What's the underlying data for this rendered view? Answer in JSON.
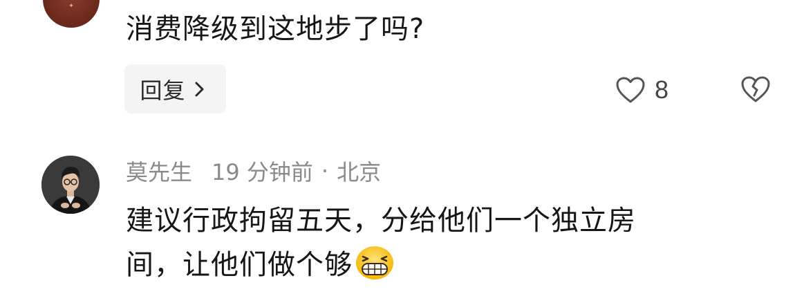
{
  "comment_1": {
    "text": "消费降级到这地步了吗?",
    "reply_label": "回复",
    "like_count": "8"
  },
  "comment_2": {
    "username": "莫先生",
    "time": "19 分钟前",
    "separator": "·",
    "location": "北京",
    "text_line_1": "建议行政拘留五天，分给他们一个独立房",
    "text_line_2": "间，让他们做个够"
  },
  "icons": {
    "reply_chevron": "chevron-right-icon",
    "like": "heart-outline-icon",
    "dislike": "broken-heart-icon",
    "emoji": "grinning-face-emoji"
  },
  "colors": {
    "text_primary": "#161616",
    "text_meta": "#8a8a8a",
    "reply_bg": "#f4f4f4",
    "icon_stroke": "#555555",
    "avatar_top": "#6e2a1f"
  }
}
